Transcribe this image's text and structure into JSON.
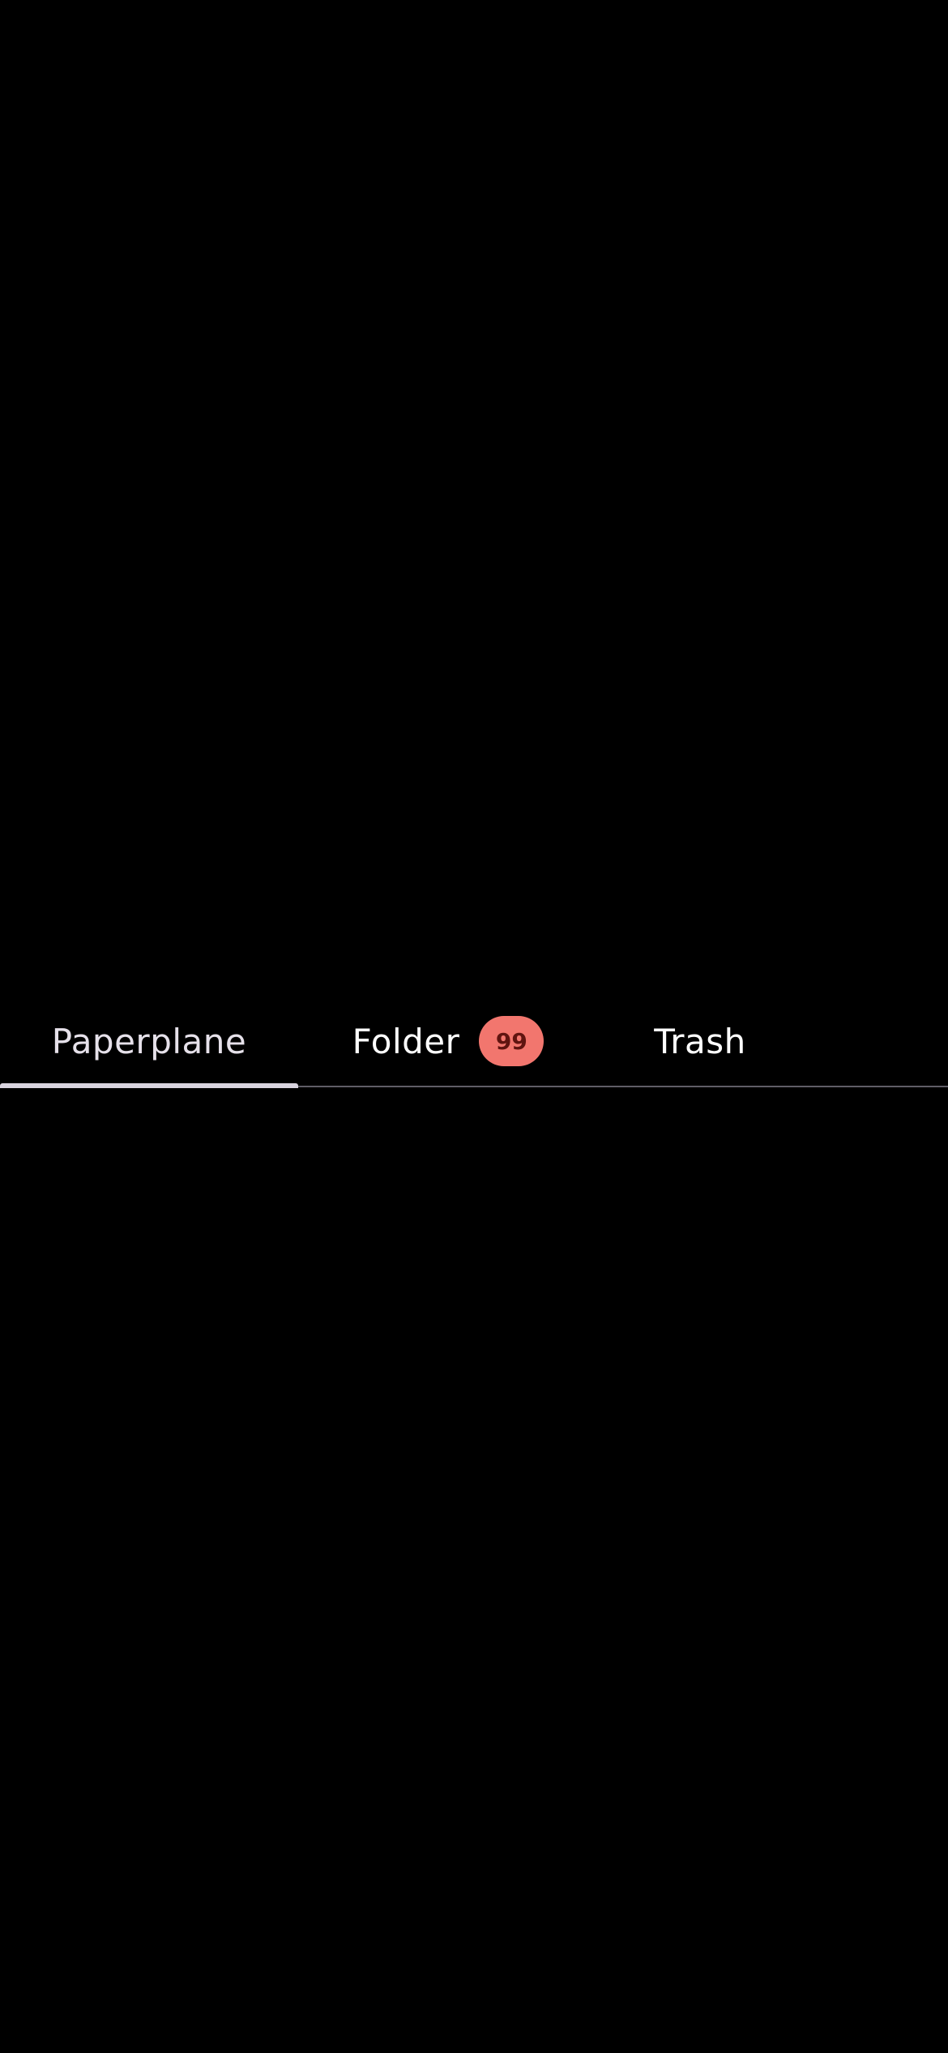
{
  "tabs": [
    {
      "label": "Paperplane",
      "active": true
    },
    {
      "label": "Folder",
      "badge": "99",
      "active": false
    },
    {
      "label": "Trash",
      "active": false
    }
  ],
  "colors": {
    "background": "#000000",
    "badge_background": "#f2766e",
    "indicator": "#d9d4df",
    "divider": "#5f5d66"
  }
}
